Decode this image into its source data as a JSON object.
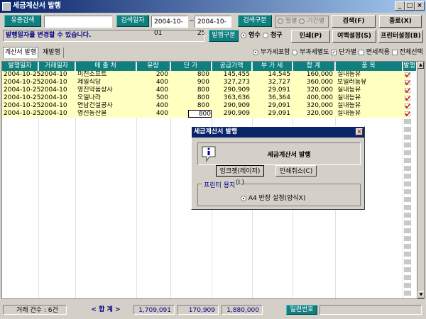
{
  "window": {
    "title": "세금계산서 발행"
  },
  "toolbar": {
    "reissue_search": "유증검색",
    "search_date_label": "검색일자",
    "date_from": "2004-10-01",
    "date_sep": "~",
    "date_to": "2004-10-25",
    "search_type_label": "검색구분",
    "opt_month": "월별",
    "opt_period": "기간별",
    "search_btn": "검색(F)",
    "close_btn": "종료(X)"
  },
  "row2": {
    "notice": "발행일자를 변경할 수 있습니다.",
    "issue_type_label": "발행구분",
    "opt_receipt": "영수",
    "opt_claim": "청구",
    "print_btn": "인쇄(P)",
    "margin_btn": "여백설정(S)",
    "printer_btn": "프린터설정(B)"
  },
  "row3": {
    "tab_issue": "계산서 발행",
    "tab_reissue": "재발행",
    "opt_vat_incl": "부가세포함",
    "opt_vat_sep": "부과세별도",
    "chk_unit_price": "단가별",
    "chk_tax_free": "면세적용",
    "chk_select_all": "전체선택"
  },
  "grid": {
    "headers": [
      "발행일자",
      "거래일자",
      "매 출 처",
      "유량",
      "단 가",
      "공급가액",
      "부 가 세",
      "합 계",
      "품 목",
      "발행"
    ],
    "rows": [
      [
        "2004-10-25",
        "2004-10",
        "미진소프트",
        "200",
        "800",
        "145,455",
        "14,545",
        "160,000",
        "실내등유"
      ],
      [
        "2004-10-25",
        "2004-10",
        "제일식당",
        "400",
        "900",
        "327,273",
        "32,727",
        "360,000",
        "보일러등유"
      ],
      [
        "2004-10-25",
        "2004-10",
        "영진약품상사",
        "400",
        "800",
        "290,909",
        "29,091",
        "320,000",
        "실내등유"
      ],
      [
        "2004-10-25",
        "2004-10",
        "오일나라",
        "500",
        "800",
        "363,636",
        "36,364",
        "400,000",
        "실내등유"
      ],
      [
        "2004-10-25",
        "2004-10",
        "연남건설공사",
        "400",
        "800",
        "290,909",
        "29,091",
        "320,000",
        "실내등유"
      ],
      [
        "2004-10-25",
        "2004-10",
        "영선농산물",
        "400",
        "800",
        "290,909",
        "29,091",
        "320,000",
        "실내등유"
      ]
    ]
  },
  "dialog": {
    "title": "세금계산서 발행",
    "heading": "세금계산서 발행",
    "inkjet_btn": "잉크젯(레이저)(L)",
    "cancel_btn": "인쇄취소(C)",
    "paper_label": "프린터 용지",
    "paper_opt": "A4 반장 설정(양식X)"
  },
  "status": {
    "count": "거래 건수 : 6건",
    "total_label": "< 합   계 >",
    "supply_total": "1,709,091",
    "vat_total": "170,909",
    "grand_total": "1,880,000",
    "serial_label": "일련번호"
  }
}
